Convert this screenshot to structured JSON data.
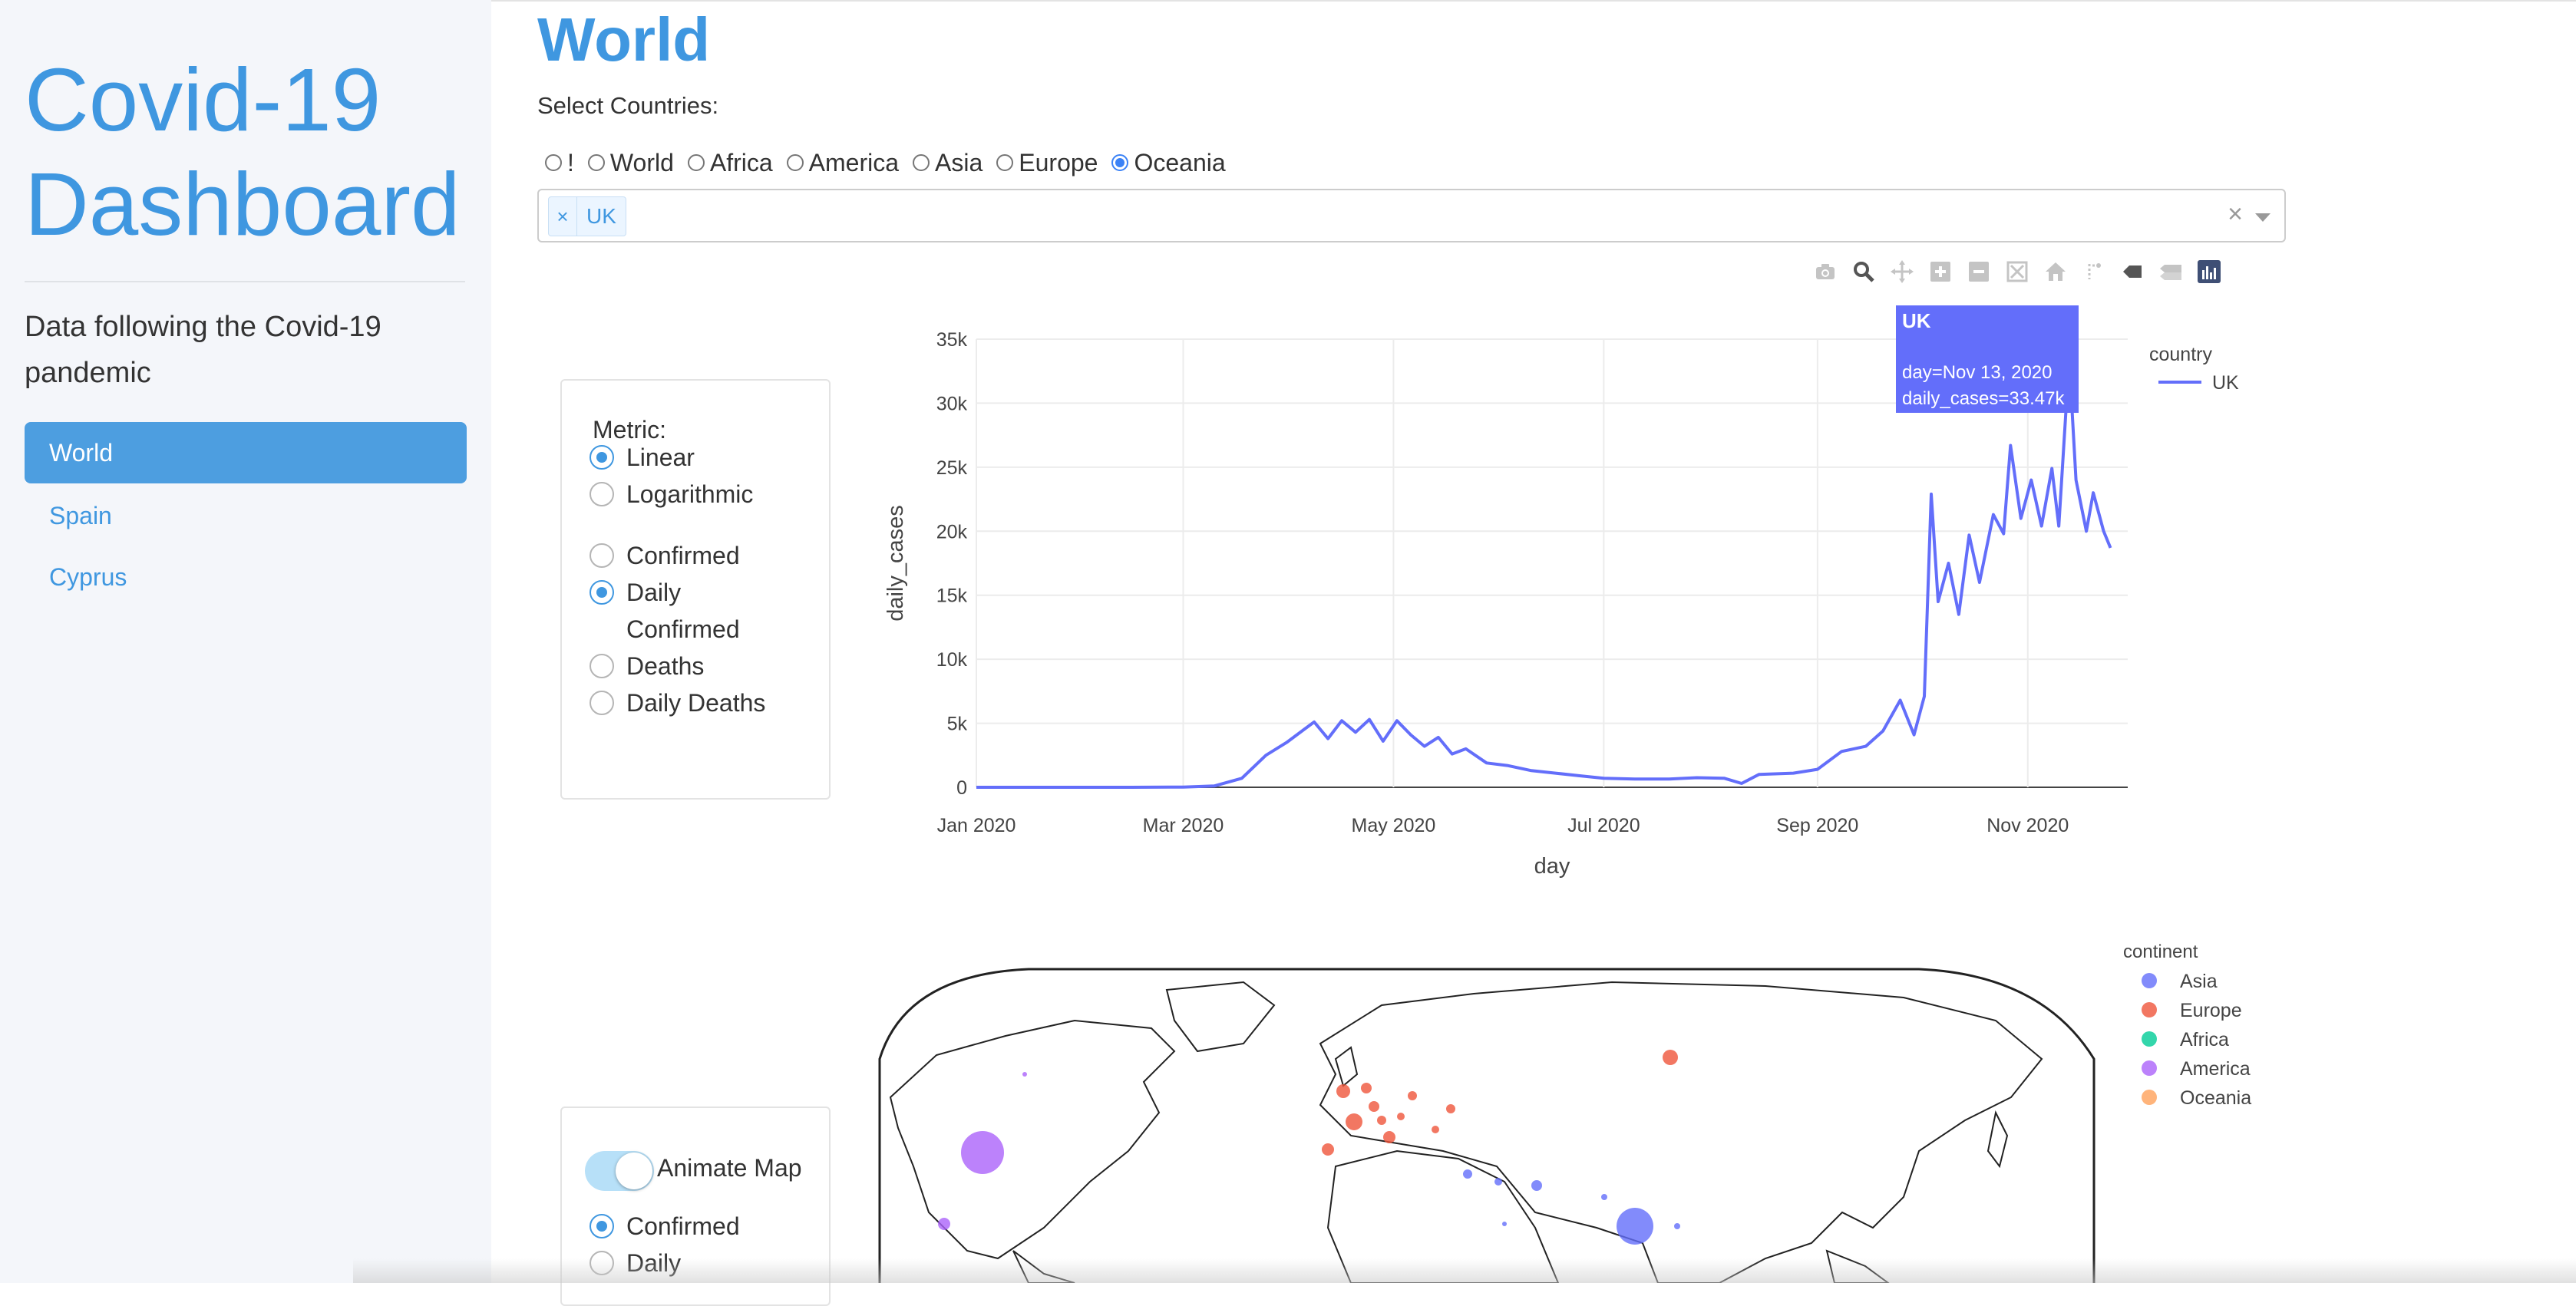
{
  "app": {
    "title": "Covid-19 Dashboard",
    "subtitle": "Data following the Covid-19 pandemic"
  },
  "sidebar": {
    "items": [
      {
        "label": "World",
        "active": true
      },
      {
        "label": "Spain",
        "active": false
      },
      {
        "label": "Cyprus",
        "active": false
      }
    ]
  },
  "page": {
    "title": "World",
    "select_label": "Select Countries:"
  },
  "region_radios": {
    "options": [
      "!",
      "World",
      "Africa",
      "America",
      "Asia",
      "Europe",
      "Oceania"
    ],
    "selected": "Oceania"
  },
  "country_select": {
    "chips": [
      "UK"
    ],
    "clear_symbol": "×"
  },
  "modebar": {
    "icons": [
      "camera-icon",
      "zoom-icon",
      "pan-icon",
      "zoom-in-icon",
      "zoom-out-icon",
      "autoscale-icon",
      "reset-axes-icon",
      "spike-lines-icon",
      "hover-closest-icon",
      "hover-compare-icon",
      "plotly-logo-icon"
    ]
  },
  "metric_panel": {
    "label": "Metric:",
    "scale_options": [
      {
        "label": "Linear",
        "selected": true
      },
      {
        "label": "Logarithmic",
        "selected": false
      }
    ],
    "metric_options": [
      {
        "label": "Confirmed",
        "selected": false
      },
      {
        "label": "Daily Confirmed",
        "selected": true
      },
      {
        "label": "Deaths",
        "selected": false
      },
      {
        "label": "Daily Deaths",
        "selected": false
      }
    ]
  },
  "animate_panel": {
    "toggle_label": "Animate Map",
    "toggle_on": true,
    "options": [
      {
        "label": "Confirmed",
        "selected": true
      },
      {
        "label": "Daily",
        "selected": false
      }
    ]
  },
  "chart_data": [
    {
      "type": "line",
      "xlabel": "day",
      "ylabel": "daily_cases",
      "x_ticks": [
        "Jan 2020",
        "Mar 2020",
        "May 2020",
        "Jul 2020",
        "Sep 2020",
        "Nov 2020"
      ],
      "y_ticks": [
        "0",
        "5k",
        "10k",
        "15k",
        "20k",
        "25k",
        "30k",
        "35k"
      ],
      "ylim": [
        0,
        35000
      ],
      "xlim": [
        "2020-01-01",
        "2020-11-30"
      ],
      "grid": true,
      "legend_title": "country",
      "legend_position": "top-right",
      "series": [
        {
          "name": "UK",
          "color": "#636efa",
          "points": [
            [
              "2020-01-01",
              0
            ],
            [
              "2020-02-15",
              0
            ],
            [
              "2020-03-01",
              20
            ],
            [
              "2020-03-10",
              100
            ],
            [
              "2020-03-18",
              700
            ],
            [
              "2020-03-25",
              2500
            ],
            [
              "2020-03-31",
              3500
            ],
            [
              "2020-04-05",
              4500
            ],
            [
              "2020-04-08",
              5100
            ],
            [
              "2020-04-12",
              3800
            ],
            [
              "2020-04-16",
              5200
            ],
            [
              "2020-04-20",
              4300
            ],
            [
              "2020-04-24",
              5300
            ],
            [
              "2020-04-28",
              3600
            ],
            [
              "2020-05-02",
              5200
            ],
            [
              "2020-05-06",
              4100
            ],
            [
              "2020-05-10",
              3200
            ],
            [
              "2020-05-14",
              3900
            ],
            [
              "2020-05-18",
              2600
            ],
            [
              "2020-05-22",
              3000
            ],
            [
              "2020-05-28",
              1900
            ],
            [
              "2020-06-03",
              1700
            ],
            [
              "2020-06-10",
              1300
            ],
            [
              "2020-06-17",
              1100
            ],
            [
              "2020-06-24",
              900
            ],
            [
              "2020-07-01",
              700
            ],
            [
              "2020-07-10",
              650
            ],
            [
              "2020-07-20",
              650
            ],
            [
              "2020-07-28",
              750
            ],
            [
              "2020-08-05",
              700
            ],
            [
              "2020-08-10",
              300
            ],
            [
              "2020-08-15",
              1000
            ],
            [
              "2020-08-25",
              1100
            ],
            [
              "2020-09-01",
              1400
            ],
            [
              "2020-09-08",
              2800
            ],
            [
              "2020-09-15",
              3200
            ],
            [
              "2020-09-20",
              4400
            ],
            [
              "2020-09-25",
              6800
            ],
            [
              "2020-09-29",
              4100
            ],
            [
              "2020-10-02",
              7100
            ],
            [
              "2020-10-04",
              22900
            ],
            [
              "2020-10-06",
              14500
            ],
            [
              "2020-10-09",
              17500
            ],
            [
              "2020-10-12",
              13500
            ],
            [
              "2020-10-15",
              19700
            ],
            [
              "2020-10-18",
              16000
            ],
            [
              "2020-10-22",
              21300
            ],
            [
              "2020-10-25",
              19800
            ],
            [
              "2020-10-27",
              26700
            ],
            [
              "2020-10-30",
              21000
            ],
            [
              "2020-11-02",
              24000
            ],
            [
              "2020-11-05",
              20400
            ],
            [
              "2020-11-08",
              24900
            ],
            [
              "2020-11-10",
              20400
            ],
            [
              "2020-11-13",
              33470
            ],
            [
              "2020-11-15",
              24000
            ],
            [
              "2020-11-18",
              20000
            ],
            [
              "2020-11-20",
              23000
            ],
            [
              "2020-11-23",
              20000
            ],
            [
              "2020-11-25",
              18700
            ]
          ]
        }
      ],
      "hover": {
        "title": "UK",
        "line1": "day=Nov 13, 2020",
        "line2": "daily_cases=33.47k"
      }
    },
    {
      "type": "scatter",
      "subtype": "scatter_geo",
      "legend_title": "continent",
      "legend_position": "top-right",
      "series": [
        {
          "name": "Asia",
          "color": "#636efa"
        },
        {
          "name": "Europe",
          "color": "#ef553b"
        },
        {
          "name": "Africa",
          "color": "#00cc96"
        },
        {
          "name": "America",
          "color": "#ab63fa"
        },
        {
          "name": "Oceania",
          "color": "#ffa15a"
        }
      ]
    }
  ]
}
